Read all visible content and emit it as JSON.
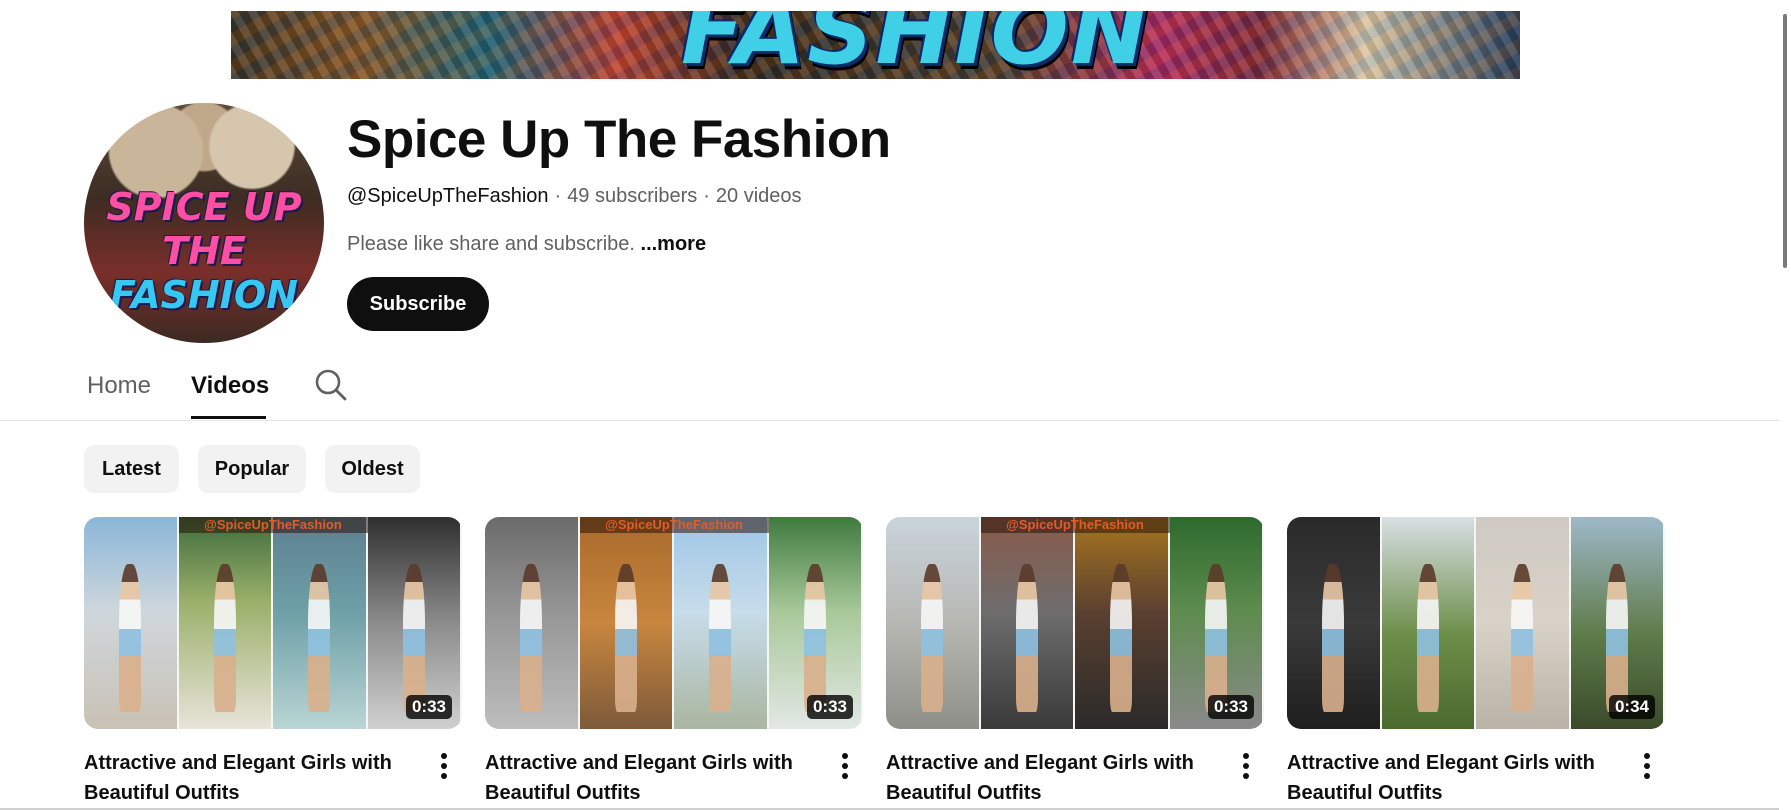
{
  "banner": {
    "wordmark": "FASHION"
  },
  "channel": {
    "avatar_line1": "SPICE UP THE",
    "avatar_line2": "FASHION",
    "name": "Spice Up The Fashion",
    "handle": "@SpiceUpTheFashion",
    "separator": "·",
    "subscribers": "49 subscribers",
    "videos_count": "20 videos",
    "description": "Please like share and subscribe.",
    "more_label": "...more",
    "subscribe_label": "Subscribe"
  },
  "tabs": [
    {
      "label": "Home"
    },
    {
      "label": "Videos"
    }
  ],
  "filters": [
    {
      "label": "Latest"
    },
    {
      "label": "Popular"
    },
    {
      "label": "Oldest"
    }
  ],
  "videos": [
    {
      "watermark": "@SpiceUpTheFashion",
      "duration": "0:33",
      "title": "Attractive and Elegant Girls with Beautiful Outfits"
    },
    {
      "watermark": "@SpiceUpTheFashion",
      "duration": "0:33",
      "title": "Attractive and Elegant Girls with Beautiful Outfits"
    },
    {
      "watermark": "@SpiceUpTheFashion",
      "duration": "0:33",
      "title": "Attractive and Elegant Girls with Beautiful Outfits"
    },
    {
      "watermark": "",
      "duration": "0:34",
      "title": "Attractive and Elegant Girls with Beautiful Outfits"
    }
  ],
  "icons": {
    "search": "search-icon",
    "more": "more-vertical-icon"
  },
  "colors": {
    "text_primary": "#0f0f0f",
    "text_secondary": "#606060",
    "chip_bg": "#f2f2f2",
    "subscribe_bg": "#0f0f0f"
  }
}
